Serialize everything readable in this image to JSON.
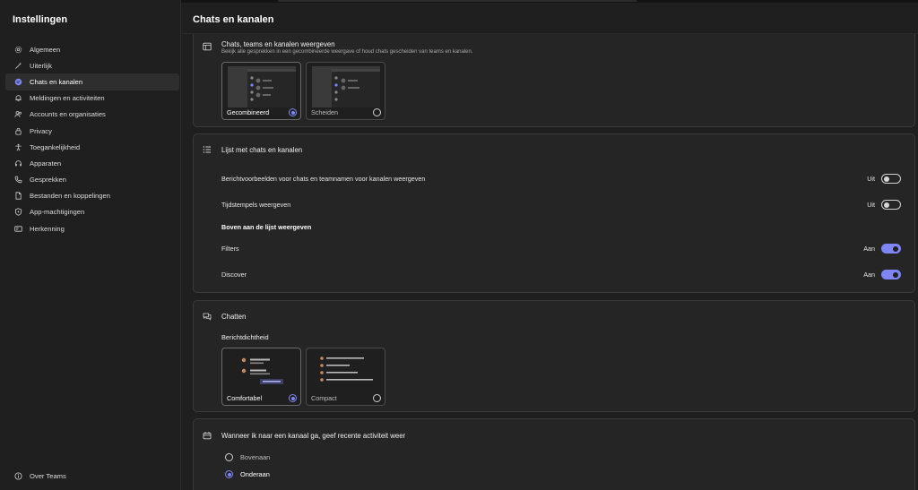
{
  "sidebar": {
    "title": "Instellingen",
    "items": [
      {
        "label": "Algemeen",
        "icon": "gear-icon"
      },
      {
        "label": "Uiterlijk",
        "icon": "wand-icon"
      },
      {
        "label": "Chats en kanalen",
        "icon": "chat-icon",
        "active": true
      },
      {
        "label": "Meldingen en activiteiten",
        "icon": "bell-icon"
      },
      {
        "label": "Accounts en organisaties",
        "icon": "people-icon"
      },
      {
        "label": "Privacy",
        "icon": "lock-icon"
      },
      {
        "label": "Toegankelijkheid",
        "icon": "accessibility-icon"
      },
      {
        "label": "Apparaten",
        "icon": "headset-icon"
      },
      {
        "label": "Gesprekken",
        "icon": "phone-icon"
      },
      {
        "label": "Bestanden en koppelingen",
        "icon": "file-icon"
      },
      {
        "label": "App-machtigingen",
        "icon": "shield-icon"
      },
      {
        "label": "Herkenning",
        "icon": "id-card-icon"
      }
    ],
    "about": "Over Teams"
  },
  "main": {
    "title": "Chats en kanalen",
    "layout": {
      "heading": "Chats, teams en kanalen weergeven",
      "description": "Bekijk alle gesprekken in een gecombineerde weergave of houd chats gescheiden van teams en kanalen.",
      "options": [
        {
          "label": "Gecombineerd",
          "selected": true
        },
        {
          "label": "Scheiden",
          "selected": false
        }
      ]
    },
    "list": {
      "heading": "Lijst met chats en kanalen",
      "rows": [
        {
          "label": "Berichtvoorbeelden voor chats en teamnamen voor kanalen weergeven",
          "state": "Uit",
          "on": false
        },
        {
          "label": "Tijdstempels weergeven",
          "state": "Uit",
          "on": false
        }
      ],
      "top_heading": "Boven aan de lijst weergeven",
      "top_rows": [
        {
          "label": "Filters",
          "state": "Aan",
          "on": true
        },
        {
          "label": "Discover",
          "state": "Aan",
          "on": true
        }
      ]
    },
    "chat": {
      "heading": "Chatten",
      "density_label": "Berichtdichtheid",
      "options": [
        {
          "label": "Comfortabel",
          "selected": true
        },
        {
          "label": "Compact",
          "selected": false
        }
      ]
    },
    "channel": {
      "heading": "Wanneer ik naar een kanaal ga, geef recente activiteit weer",
      "options": [
        {
          "label": "Bovenaan",
          "selected": false
        },
        {
          "label": "Onderaan",
          "selected": true
        }
      ]
    }
  },
  "colors": {
    "accent": "#7f85f5",
    "background": "#1f1f1f",
    "card": "#252525"
  }
}
